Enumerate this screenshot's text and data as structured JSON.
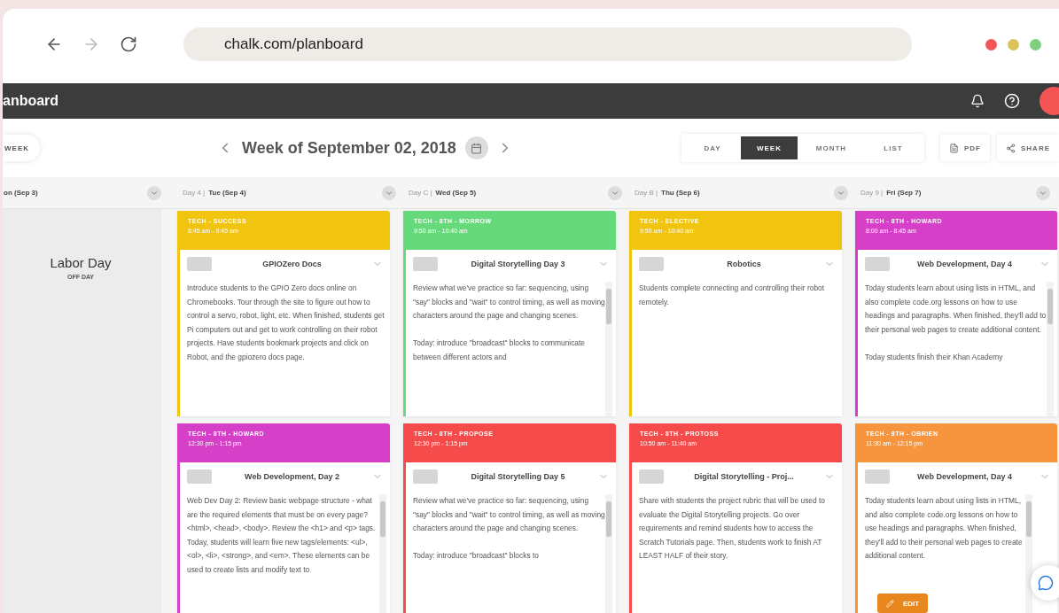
{
  "browser": {
    "url": "chalk.com/planboard"
  },
  "app": {
    "title": "anboard"
  },
  "toolbar": {
    "left_button": "WEEK",
    "week_label": "Week of September 02, 2018",
    "views": [
      {
        "label": "DAY",
        "selected": false
      },
      {
        "label": "WEEK",
        "selected": true
      },
      {
        "label": "MONTH",
        "selected": false
      },
      {
        "label": "LIST",
        "selected": false
      }
    ],
    "actions": [
      {
        "label": "PDF",
        "kind": "pdf"
      },
      {
        "label": "SHARE",
        "kind": "share"
      }
    ]
  },
  "days": [
    {
      "label": "on (Sep 3)",
      "holiday": {
        "title": "Labor Day",
        "note": "OFF DAY"
      }
    },
    {
      "prefix": "Day 4 |",
      "label": "Tue (Sep 4)",
      "events": [
        {
          "color": "#f1c40f",
          "class": "TECH - SUCCESS",
          "time": "8:45 am - 9:45 am",
          "lesson": "GPIOZero Docs",
          "scrollable": false,
          "body": "Introduce students to the GPIO Zero docs online on Chromebooks. Tour through the site to figure out how to control a servo, robot, light, etc. When finished, students get Pi computers out and get to work controlling on their robot projects. Have students bookmark projects and click on Robot, and the gpiozero docs page."
        },
        {
          "color": "#d63fc8",
          "class": "TECH - 8TH - HOWARD",
          "time": "12:30 pm - 1:15 pm",
          "lesson": "Web Development, Day 2",
          "scrollable": true,
          "body": "Web Dev Day 2: Review basic webpage structure - what are the required elements that must be on every page? <html>, <head>, <body>. Review the <h1> and <p> tags. Today, students will learn five new tags/elements: <ul>, <ol>, <li>, <strong>, and <em>. These elements can be used to create lists and modify text to"
        }
      ]
    },
    {
      "prefix": "Day C |",
      "label": "Wed (Sep 5)",
      "events": [
        {
          "color": "#66d97a",
          "class": "TECH - 8TH - MORROW",
          "time": "9:50 am - 10:40 am",
          "lesson": "Digital Storytelling Day 3",
          "scrollable": true,
          "body": "Review what we've practice so far: sequencing, using \"say\" blocks and \"wait\" to control timing, as well as moving characters around the page and changing scenes.\n\nToday: introduce \"broadcast\" blocks to communicate between different actors and"
        },
        {
          "color": "#f54b4b",
          "class": "TECH - 8TH - PROPOSE",
          "time": "12:30 pm - 1:15 pm",
          "lesson": "Digital Storytelling Day 5",
          "scrollable": true,
          "body": "Review what we've practice so far: sequencing, using \"say\" blocks and \"wait\" to control timing, as well as moving characters around the page and changing scenes.\n\nToday: introduce \"broadcast\" blocks to"
        }
      ]
    },
    {
      "prefix": "Day B |",
      "label": "Thu (Sep 6)",
      "events": [
        {
          "color": "#f1c40f",
          "class": "TECH - ELECTIVE",
          "time": "9:50 am - 10:40 am",
          "lesson": "Robotics",
          "scrollable": false,
          "body": "Students complete connecting and controlling their robot remotely."
        },
        {
          "color": "#f54b4b",
          "class": "TECH - 8TH - PROTOSS",
          "time": "10:50 am - 11:40 am",
          "lesson": "Digital Storytelling - Proj...",
          "scrollable": false,
          "body": "Share with students the project rubric that will be used to evaluate the Digital Storytelling projects. Go over requirements and remind students how to access the Scratch Tutorials page. Then, students work to finish AT LEAST HALF of their story."
        }
      ]
    },
    {
      "prefix": "Day 9 |",
      "label": "Fri (Sep 7)",
      "events": [
        {
          "color": "#d63fc8",
          "class": "TECH - 8TH - HOWARD",
          "time": "8:00 am - 8:45 am",
          "lesson": "Web Development, Day 4",
          "scrollable": true,
          "body": "Today students learn about using lists in HTML, and also complete code.org lessons on how to use headings and paragraphs. When finished, they'll add to their personal web pages to create additional content.\n\nToday students finish their Khan Academy"
        },
        {
          "color": "#f7953f",
          "class": "TECH - 8TH - OBRIEN",
          "time": "11:30 am - 12:15 pm",
          "lesson": "Web Development, Day 4",
          "scrollable": true,
          "action": "EDIT",
          "body": "Today students learn about using lists in HTML, and also complete code.org lessons on how to use headings and paragraphs. When finished, they'll add to their personal web pages to create additional content."
        }
      ]
    }
  ]
}
